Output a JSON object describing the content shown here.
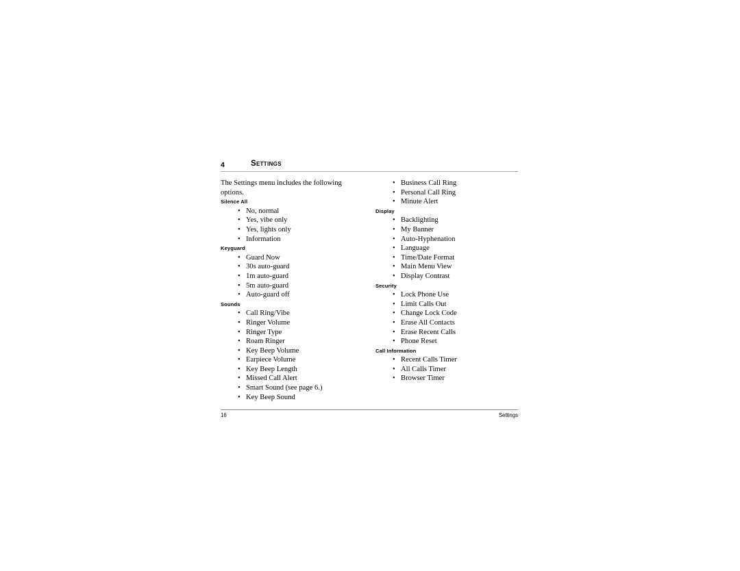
{
  "document": {
    "chapter_number": "4",
    "chapter_title": "Settings",
    "intro": "The Settings menu includes the following options.",
    "bullet_glyph": "•"
  },
  "left_column": {
    "sections": [
      {
        "heading": "Silence All",
        "items": [
          "No, normal",
          "Yes, vibe only",
          "Yes, lights only",
          "Information"
        ]
      },
      {
        "heading": "Keyguard",
        "items": [
          "Guard Now",
          "30s auto-guard",
          "1m auto-guard",
          "5m auto-guard",
          "Auto-guard off"
        ]
      },
      {
        "heading": "Sounds",
        "items": [
          "Call Ring/Vibe",
          "Ringer Volume",
          "Ringer Type",
          "Roam Ringer",
          "Key Beep Volume",
          "Earpiece Volume",
          "Key Beep Length",
          "Missed Call Alert",
          "Smart Sound (see page 6.)",
          "Key Beep Sound"
        ]
      }
    ]
  },
  "right_column": {
    "continued_items": [
      "Business Call Ring",
      "Personal Call Ring",
      "Minute Alert"
    ],
    "sections": [
      {
        "heading": "Display",
        "items": [
          "Backlighting",
          "My Banner",
          "Auto-Hyphenation",
          "Language",
          "Time/Date Format",
          "Main Menu View",
          "Display Contrast"
        ]
      },
      {
        "heading": "Security",
        "items": [
          "Lock Phone Use",
          "Limit Calls Out",
          "Change Lock Code",
          "Erase All Contacts",
          "Erase Recent Calls",
          "Phone Reset"
        ]
      },
      {
        "heading": "Call Information",
        "items": [
          "Recent Calls Timer",
          "All Calls Timer",
          "Browser Timer"
        ]
      }
    ]
  },
  "footer": {
    "page_number": "16",
    "section_label": "Settings"
  }
}
